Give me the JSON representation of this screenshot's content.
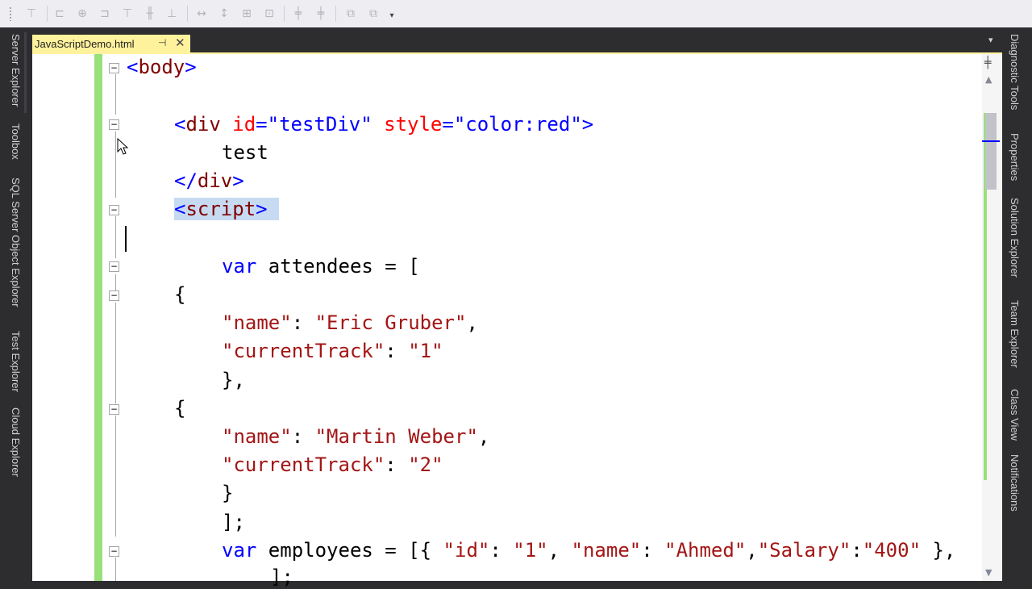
{
  "toolbar": {
    "icons": [
      "indent-decrease-icon",
      "indent-increase-icon",
      "align-left-icon",
      "align-center-icon",
      "align-right-icon",
      "align-top-icon",
      "align-middle-icon",
      "align-bottom-icon",
      "space-horizontal-icon",
      "space-vertical-icon",
      "same-size-icon",
      "center-icon",
      "order-front-icon",
      "order-back-icon",
      "group-icon",
      "ungroup-icon",
      "dropdown-icon"
    ]
  },
  "left_tools": [
    "Server Explorer",
    "Toolbox",
    "SQL Server Object Explorer",
    "Test Explorer",
    "Cloud Explorer"
  ],
  "right_tools": [
    "Diagnostic Tools",
    "Properties",
    "Solution Explorer",
    "Team Explorer",
    "Class View",
    "Notifications"
  ],
  "tab": {
    "title": "JavaScriptDemo.html",
    "pin_glyph": "⊣",
    "close_glyph": "✕"
  },
  "code": {
    "l1_open": "<",
    "l1_tag": "body",
    "l1_close": ">",
    "l2_open": "<",
    "l2_tag": "div",
    "l2_a1": "id",
    "l2_eq1": "=",
    "l2_v1": "\"testDiv\"",
    "l2_a2": "style",
    "l2_eq2": "=",
    "l2_v2": "\"color:red\"",
    "l2_close": ">",
    "l3_text": "test",
    "l4_open": "</",
    "l4_tag": "div",
    "l4_close": ">",
    "l5_open": "<",
    "l5_tag": "script",
    "l5_close": ">",
    "l6_kw": "var",
    "l6_rest": " attendees = [",
    "l7": "{",
    "l8_key": "\"name\"",
    "l8_sep": ": ",
    "l8_val": "\"Eric Gruber\"",
    "l8_end": ",",
    "l9_key": "\"currentTrack\"",
    "l9_sep": ": ",
    "l9_val": "\"1\"",
    "l10": "},",
    "l11": "{",
    "l12_key": "\"name\"",
    "l12_sep": ": ",
    "l12_val": "\"Martin Weber\"",
    "l12_end": ",",
    "l13_key": "\"currentTrack\"",
    "l13_sep": ": ",
    "l13_val": "\"2\"",
    "l14": "}",
    "l15": "];",
    "l16_kw": "var",
    "l16_a": " employees = [{ ",
    "l16_k1": "\"id\"",
    "l16_s1": ": ",
    "l16_v1": "\"1\"",
    "l16_c1": ", ",
    "l16_k2": "\"name\"",
    "l16_s2": ": ",
    "l16_v2": "\"Ahmed\"",
    "l16_c2": ",",
    "l16_k3": "\"Salary\"",
    "l16_s3": ":",
    "l16_v3": "\"400\"",
    "l16_end": " },",
    "l17": "];"
  },
  "colors": {
    "tab_active": "#fff29d",
    "change_bar": "#98e07a",
    "selection": "#c6dbf2",
    "tag": "#800000",
    "attribute": "#ff0000",
    "keyword": "#0000ff",
    "string": "#a31515"
  }
}
